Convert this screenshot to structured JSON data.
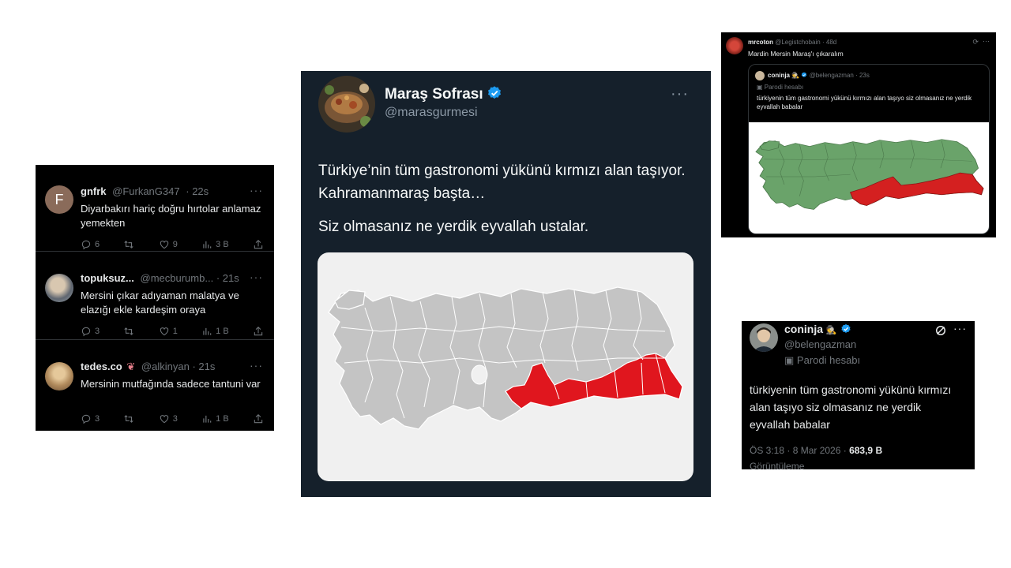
{
  "replies": [
    {
      "name": "gnfrk",
      "handle": "@FurkanG347",
      "time": "22s",
      "avatar_letter": "F",
      "text": "Diyarbakırı hariç doğru hırtolar anlamaz yemekten",
      "replies": "6",
      "likes": "9",
      "views": "3 B"
    },
    {
      "name": "topuksuz...",
      "handle": "@mecburumb...",
      "time": "21s",
      "text": "Mersini çıkar adıyaman malatya ve elazığı ekle kardeşim oraya",
      "replies": "3",
      "likes": "1",
      "views": "1 B"
    },
    {
      "name": "tedes.co",
      "handle": "@alkinyan",
      "time": "21s",
      "text": "Mersinin mutfağında sadece tantuni var",
      "replies": "3",
      "likes": "3",
      "views": "1 B"
    }
  ],
  "main_tweet": {
    "name": "Maraş Sofrası",
    "handle": "@marasgurmesi",
    "text1": "Türkiye’nin tüm gastronomi yükünü kırmızı alan taşıyor. Kahramanmaraş başta…",
    "text2": "Siz olmasanız ne yerdik eyvallah ustalar.",
    "map_colors": {
      "land": "#c4c4c4",
      "highlight": "#e0161e",
      "border": "#ffffff"
    }
  },
  "quote_tweet": {
    "name": "mrcoton",
    "handle": "@Legistchobain",
    "time": "48d",
    "text": "Mardin Mersin Maraş'ı çıkaralım",
    "quoted": {
      "name": "coninja",
      "handle": "@belengazman",
      "time": "23s",
      "parody": "Parodi hesabı",
      "text": "türkiyenin tüm gastronomi yükünü kırmızı alan taşıyo siz olmasanız ne yerdik eyvallah babalar",
      "map_colors": {
        "land": "#6aa36a",
        "highlight": "#d42020"
      }
    }
  },
  "original_tweet": {
    "name": "coninja",
    "handle": "@belengazman",
    "parody": "Parodi hesabı",
    "text": "türkiyenin tüm gastronomi yükünü kırmızı alan taşıyo siz olmasanız ne yerdik eyvallah babalar",
    "time": "ÖS 3:18 · 8 Mar 2026 ·",
    "views_count": "683,9 B",
    "views_label": "Görüntüleme"
  },
  "accent": "#1d9bf0"
}
